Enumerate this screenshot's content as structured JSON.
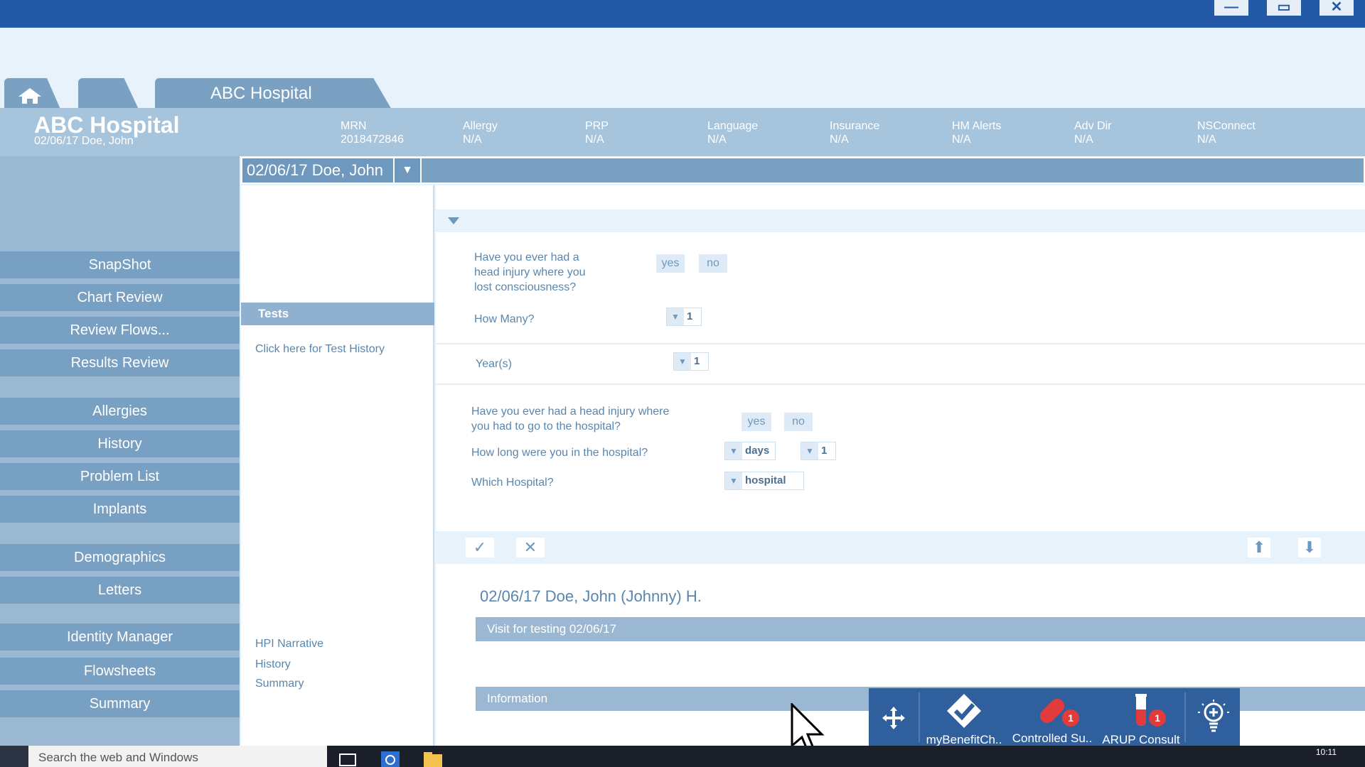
{
  "window": {
    "controls": {
      "minimize": "—",
      "maximize": "▭",
      "close": "✕"
    }
  },
  "tabs": {
    "main_label": "ABC Hospital"
  },
  "patient_header": {
    "hospital": "ABC Hospital",
    "subtitle": "02/06/17  Doe, John",
    "fields": [
      {
        "label": "MRN",
        "value": "2018472846"
      },
      {
        "label": "Allergy",
        "value": "N/A"
      },
      {
        "label": "PRP",
        "value": "N/A"
      },
      {
        "label": "Language",
        "value": "N/A"
      },
      {
        "label": "Insurance",
        "value": "N/A"
      },
      {
        "label": "HM Alerts",
        "value": "N/A"
      },
      {
        "label": "Adv Dir",
        "value": "N/A"
      },
      {
        "label": "NSConnect",
        "value": "N/A"
      }
    ]
  },
  "sidebar": {
    "items": [
      "SnapShot",
      "Chart Review",
      "Review Flows...",
      "Results Review",
      "Allergies",
      "History",
      "Problem List",
      "Implants",
      "Demographics",
      "Letters",
      "Identity Manager",
      "Flowsheets",
      "Summary"
    ]
  },
  "selector": {
    "label": "02/06/17  Doe, John",
    "dropdown": "▼"
  },
  "mid_panel": {
    "tests_heading": "Tests",
    "test_history_link": "Click here for Test History",
    "links": [
      "HPI Narrative",
      "History",
      "Summary"
    ]
  },
  "questions": {
    "q1": "Have you ever had a head injury where you lost consciousness?",
    "q1_lines": [
      "Have you ever had a",
      "head injury where you",
      "lost consciousness?"
    ],
    "yes": "yes",
    "no": "no",
    "how_many_label": "How Many?",
    "how_many_value": "1",
    "years_label": "Year(s)",
    "years_value": "1",
    "q2_lines": [
      "Have you ever had a head injury where",
      "you had to go to the hospital?"
    ],
    "how_long_label": "How long were you in the hospital?",
    "how_long_unit": "days",
    "how_long_value": "1",
    "which_hospital_label": "Which Hospital?",
    "which_hospital_value": "hospital"
  },
  "note": {
    "patient_full": "02/06/17  Doe, John (Johnny) H.",
    "visit": "Visit for testing 02/06/17",
    "information": "Information"
  },
  "tray": {
    "items": [
      {
        "label": "myBenefitCh..",
        "icon": "checkmark-shield-icon"
      },
      {
        "label": "Controlled Su..",
        "icon": "pill-icon",
        "badge": "1"
      },
      {
        "label": "ARUP Consult",
        "icon": "test-tube-icon",
        "badge": "1"
      }
    ]
  },
  "taskbar": {
    "search_placeholder": "Search the web and Windows",
    "time": "10:11"
  }
}
